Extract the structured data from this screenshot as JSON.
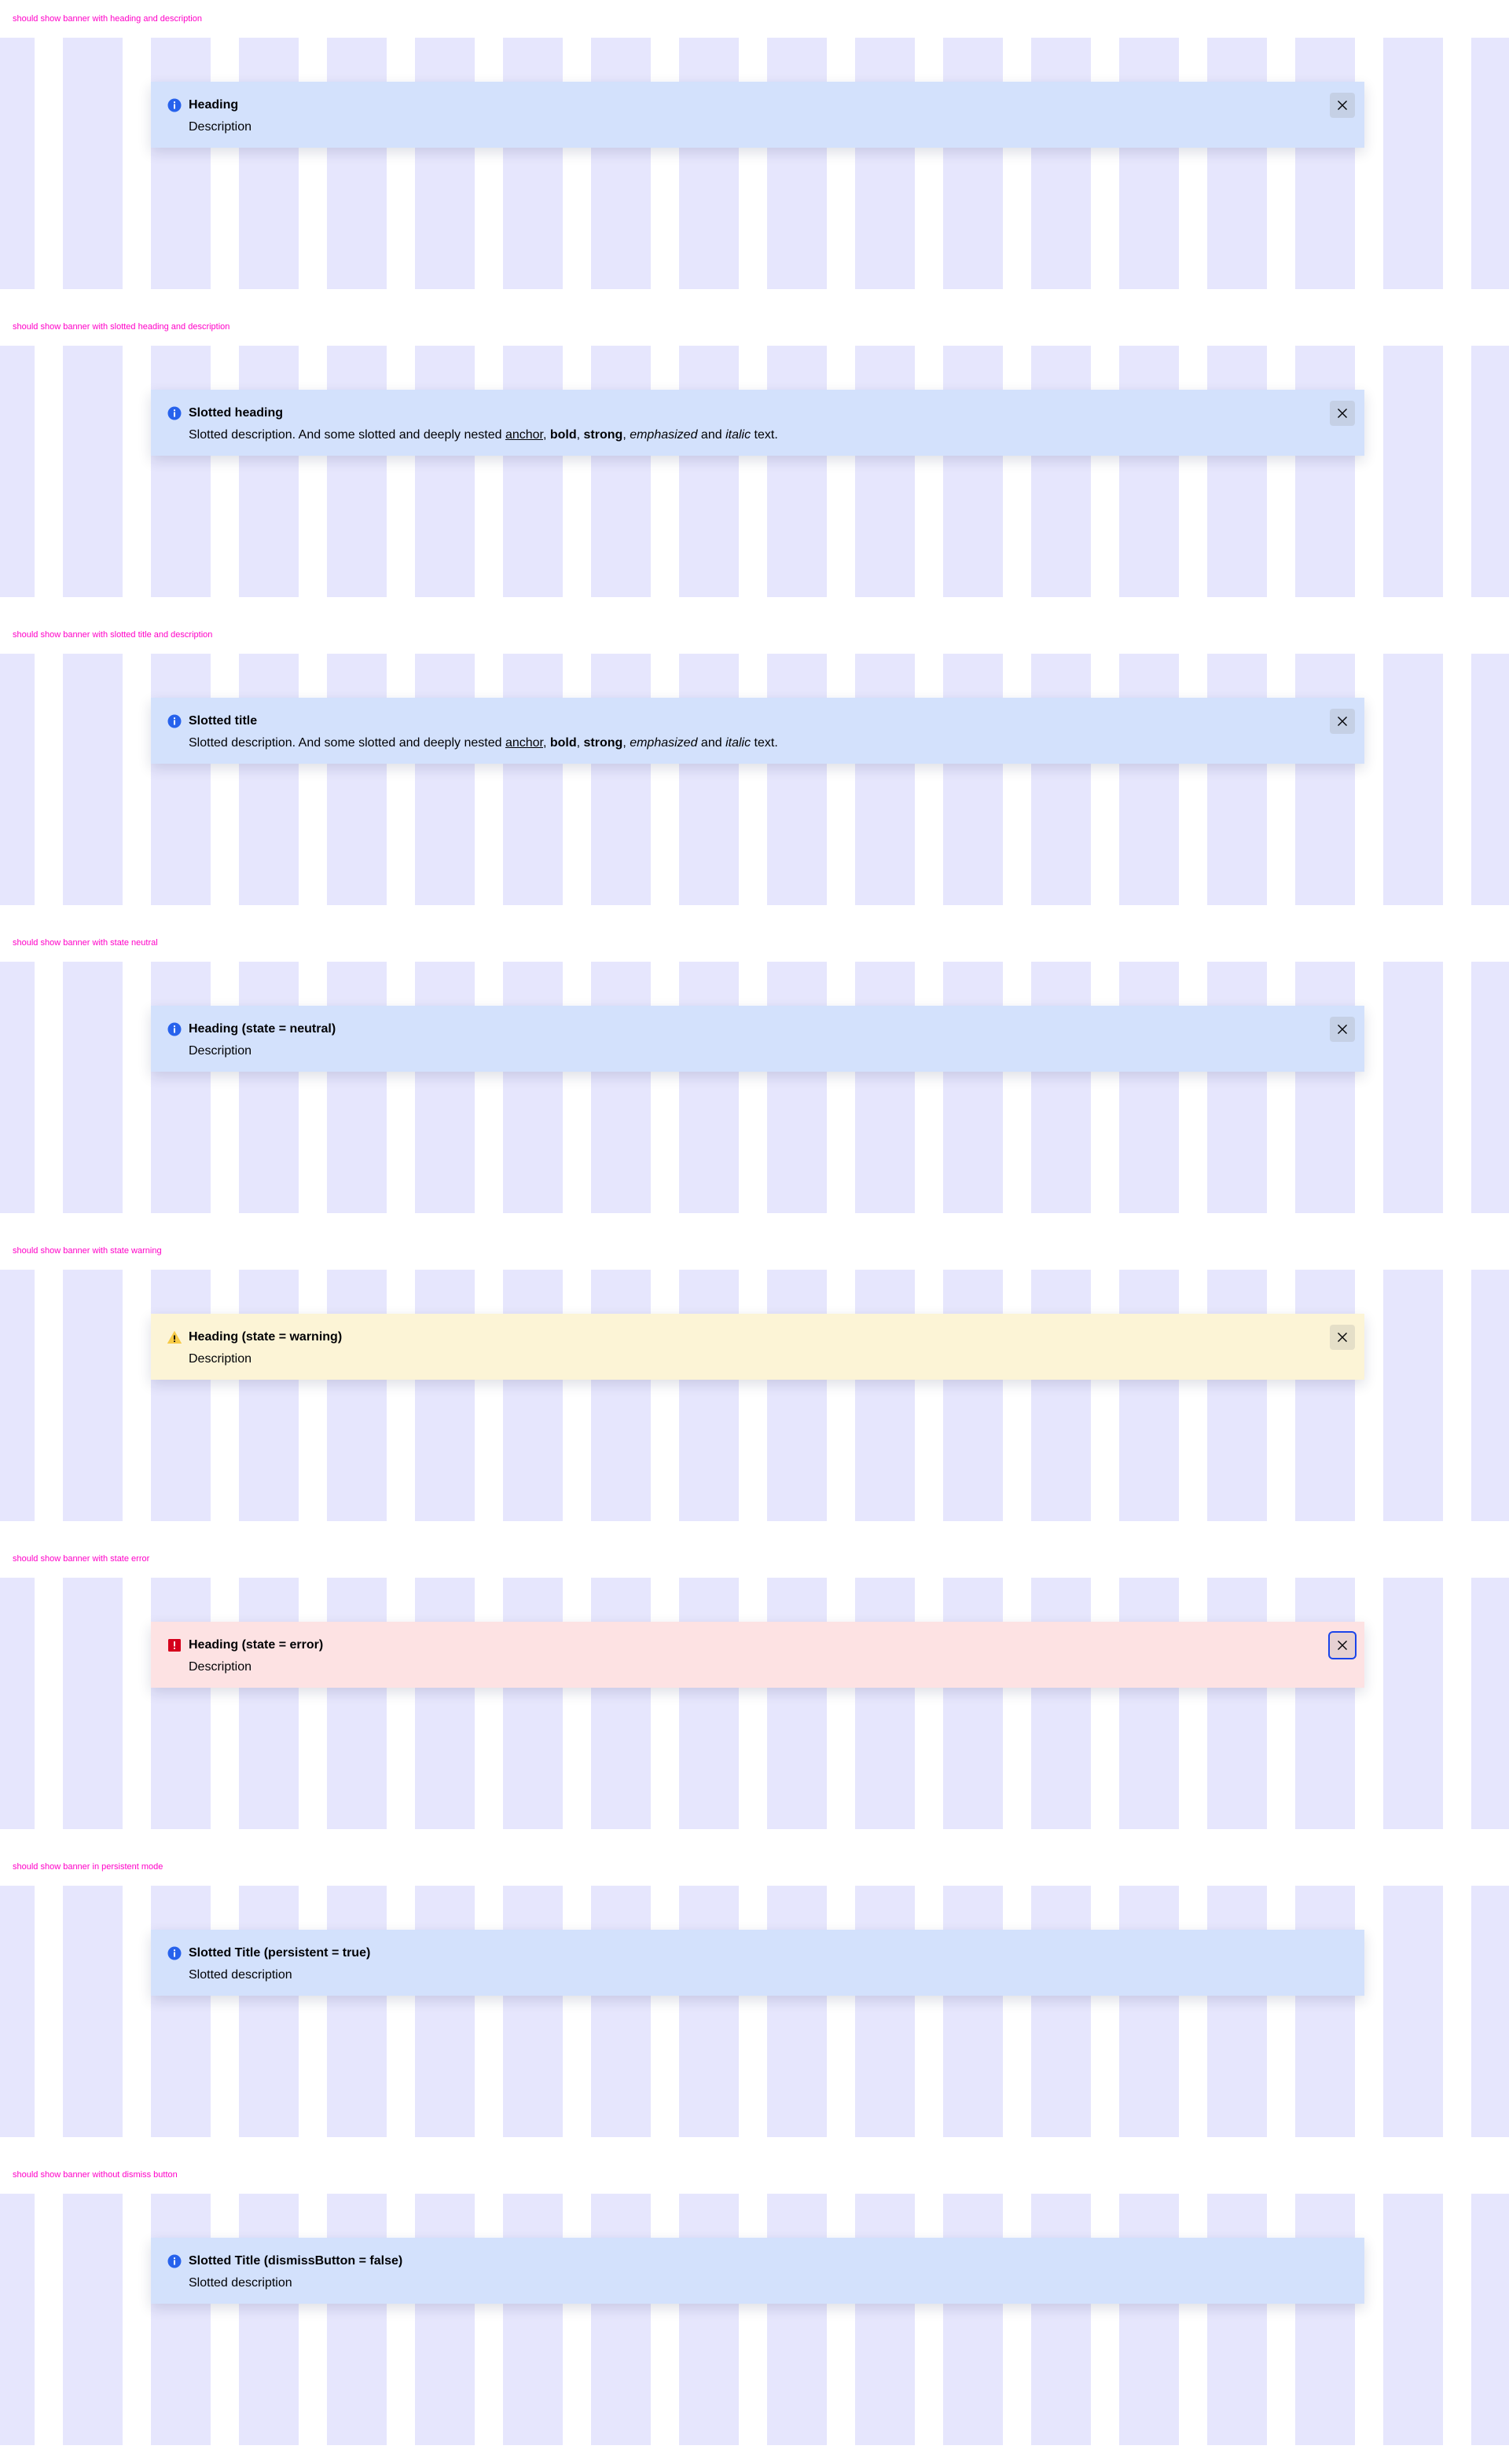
{
  "sections": [
    {
      "title": "should show banner with heading and description",
      "state": "info",
      "heading": "Heading",
      "description": "Description"
    },
    {
      "title": "should show banner with slotted heading and description",
      "state": "info",
      "heading": "Slotted heading",
      "description_parts": {
        "lead": "Slotted description. And some slotted and deeply nested ",
        "anchor": "anchor",
        "sep1": ", ",
        "bold": "bold",
        "sep2": ", ",
        "strong": "strong",
        "sep3": ", ",
        "emphasized": "emphasized",
        "sep4": " and ",
        "italic": "italic",
        "tail": " text."
      }
    },
    {
      "title": "should show banner with slotted title and description",
      "state": "info",
      "heading": "Slotted title",
      "description_parts": {
        "lead": "Slotted description. And some slotted and deeply nested ",
        "anchor": "anchor",
        "sep1": ", ",
        "bold": "bold",
        "sep2": ", ",
        "strong": "strong",
        "sep3": ", ",
        "emphasized": "emphasized",
        "sep4": " and ",
        "italic": "italic",
        "tail": " text."
      }
    },
    {
      "title": "should show banner with state neutral",
      "state": "info",
      "heading": "Heading (state = neutral)",
      "description": "Description"
    },
    {
      "title": "should show banner with state warning",
      "state": "warning",
      "heading": "Heading (state = warning)",
      "description": "Description"
    },
    {
      "title": "should show banner with state error",
      "state": "error",
      "heading": "Heading (state = error)",
      "description": "Description"
    },
    {
      "title": "should show banner in persistent mode",
      "state": "info",
      "heading": "Slotted Title (persistent = true)",
      "description": "Slotted description"
    },
    {
      "title": "should show banner without dismiss button",
      "state": "info",
      "heading": "Slotted Title (dismissButton = false)",
      "description": "Slotted description"
    }
  ],
  "colors": {
    "section_title": "#ff00c8",
    "grid_column": "#e6e6fd",
    "info_background": "#d3e1fc",
    "info_icon": "#2762ec",
    "warning_background": "#fcf4d6",
    "warning_icon": "#f7cb47",
    "error_background": "#fde2e3",
    "error_icon": "#d5001c",
    "text": "#010205",
    "focus_ring": "#1a44ea"
  },
  "icons": {
    "info": "information-icon",
    "warning": "warning-icon",
    "error": "exclamation-icon",
    "dismiss": "close-icon"
  }
}
